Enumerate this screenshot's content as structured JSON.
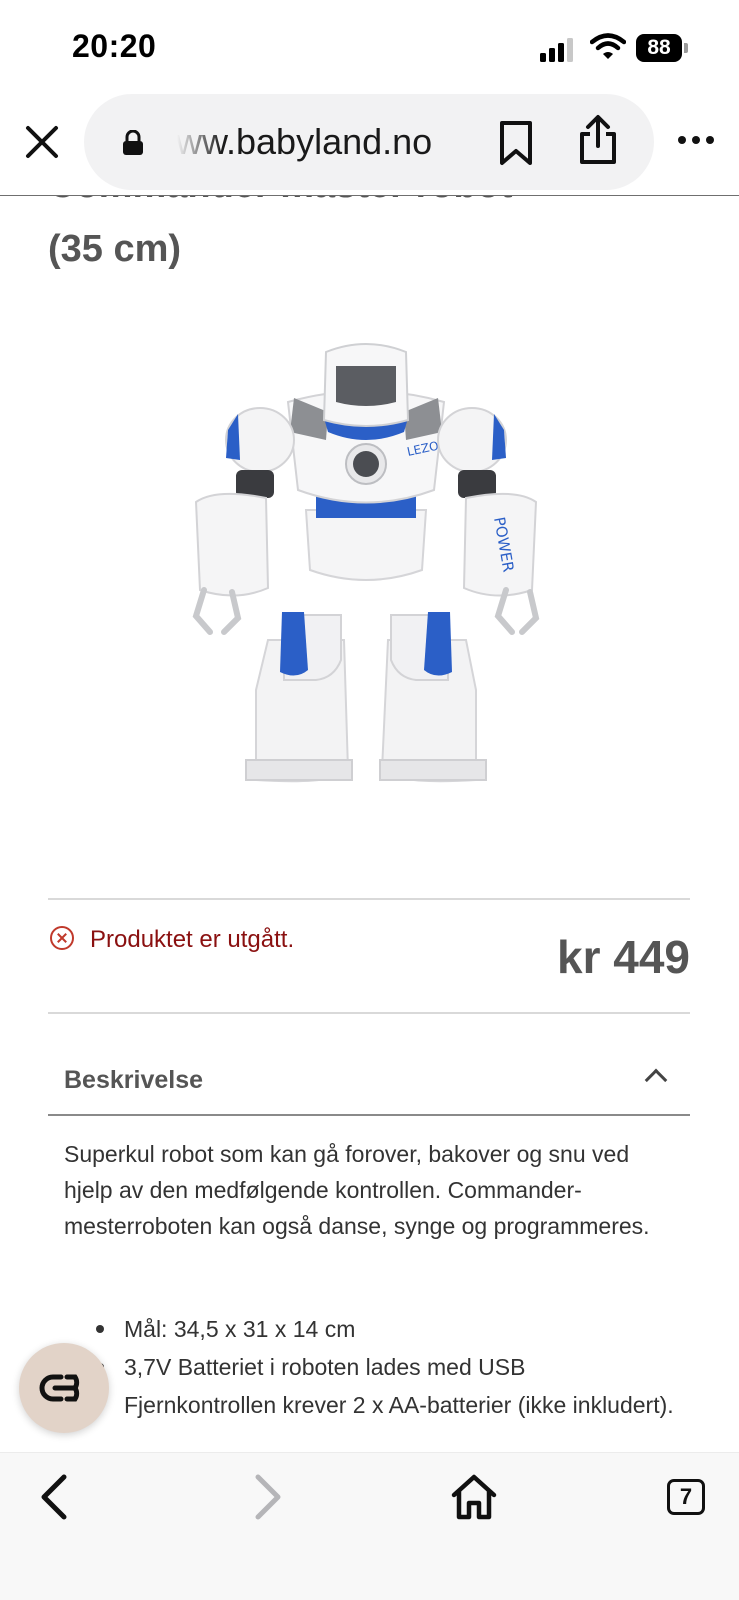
{
  "status_bar": {
    "time": "20:20",
    "battery": "88"
  },
  "browser": {
    "url": "ww.babyland.no"
  },
  "product": {
    "title_partial": "Commander master robot",
    "title_line2": "(35 cm)",
    "status_text": "Produktet er utgått.",
    "price": "kr 449"
  },
  "robot_image": {
    "arm_text": "POWER",
    "chest_text": "LEZO"
  },
  "description": {
    "heading": "Beskrivelse",
    "text": "Superkul robot som kan gå forover, bakover og snu ved hjelp av den medfølgende kontrollen. Commander-mesterroboten kan også danse, synge og programmeres.",
    "bullets": [
      "Mål: 34,5 x 31 x 14 cm",
      "3,7V Batteriet i roboten lades med USB",
      "Fjernkontrollen krever 2 x AA-batterier (ikke inkludert)."
    ]
  },
  "toolbar": {
    "tabs_count": "7"
  },
  "icons": {
    "close": "close-icon",
    "lock": "lock-icon",
    "bookmark": "bookmark-icon",
    "share": "share-icon",
    "more": "more-icon",
    "back": "back-icon",
    "forward": "forward-icon",
    "home": "home-icon",
    "chat": "chat-icon"
  },
  "colors": {
    "error": "#8a1010",
    "robot_blue": "#2b5fc7",
    "chat_bg": "#e2d3c8"
  }
}
